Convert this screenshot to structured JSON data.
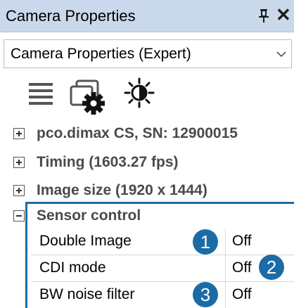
{
  "window": {
    "title": "Camera Properties",
    "pin_icon": "pin-icon",
    "close_icon": "close-icon",
    "close_glyph": "✕"
  },
  "preset_select": {
    "selected": "Camera Properties (Expert)",
    "icon": "chevron-down-icon"
  },
  "toolbar": {
    "icons": [
      "list-icon",
      "camera-settings-icon",
      "brightness-icon"
    ]
  },
  "tree": {
    "groups": [
      {
        "label": "pco.dimax CS, SN: 12900015",
        "expanded": false
      },
      {
        "label": "Timing (1603.27 fps)",
        "expanded": false
      },
      {
        "label": "Image size (1920 x 1444)",
        "expanded": false
      },
      {
        "label": "Sensor control",
        "expanded": true
      }
    ],
    "sensor_control": [
      {
        "name": "Double Image",
        "value": "Off"
      },
      {
        "name": "CDI mode",
        "value": "Off"
      },
      {
        "name": "BW noise filter",
        "value": "Off"
      }
    ]
  },
  "callouts": [
    "1",
    "2",
    "3"
  ],
  "colors": {
    "titlebar": "#c9d8ea",
    "accent": "#1b6ca6",
    "group_text": "#4a4a4a"
  }
}
